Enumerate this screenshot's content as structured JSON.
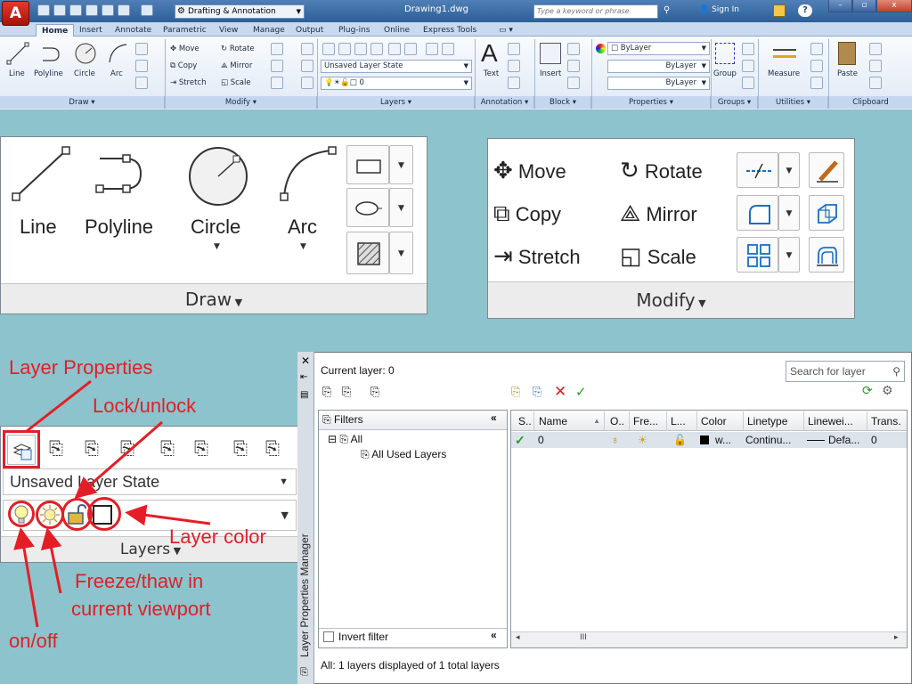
{
  "titlebar": {
    "app_button_label": "A",
    "workspace": "Drafting & Annotation",
    "document_title": "Drawing1.dwg",
    "search_placeholder": "Type a keyword or phrase",
    "sign_in": "Sign In",
    "help_label": "?",
    "minimize": "–",
    "maximize": "▫",
    "close": "x"
  },
  "tabs": [
    "Home",
    "Insert",
    "Annotate",
    "Parametric",
    "View",
    "Manage",
    "Output",
    "Plug-ins",
    "Online",
    "Express Tools"
  ],
  "ribbon": {
    "draw": {
      "title": "Draw ▾",
      "tools": [
        "Line",
        "Polyline",
        "Circle",
        "Arc"
      ]
    },
    "modify": {
      "title": "Modify ▾",
      "tools": [
        "Move",
        "Rotate",
        "Copy",
        "Mirror",
        "Stretch",
        "Scale"
      ]
    },
    "layers": {
      "title": "Layers ▾",
      "state": "Unsaved Layer State",
      "current": "0"
    },
    "annotation": {
      "title": "Annotation ▾",
      "text_label": "Text"
    },
    "block": {
      "title": "Block ▾",
      "insert_label": "Insert"
    },
    "properties": {
      "title": "Properties ▾",
      "color": "ByLayer",
      "linetype": "ByLayer",
      "lineweight": "ByLayer"
    },
    "groups": {
      "title": "Groups ▾",
      "group_label": "Group"
    },
    "utilities": {
      "title": "Utilities ▾",
      "measure_label": "Measure"
    },
    "clipboard": {
      "title": "Clipboard",
      "paste_label": "Paste"
    }
  },
  "zoom_draw": {
    "tools": [
      "Line",
      "Polyline",
      "Circle",
      "Arc"
    ],
    "footer": "Draw"
  },
  "zoom_modify": {
    "tools": [
      "Move",
      "Rotate",
      "Copy",
      "Mirror",
      "Stretch",
      "Scale"
    ],
    "footer": "Modify"
  },
  "zoom_layers": {
    "state": "Unsaved Layer State",
    "footer": "Layers"
  },
  "annotations": {
    "layer_properties": "Layer Properties",
    "lock_unlock": "Lock/unlock",
    "layer_color": "Layer color",
    "freeze_line1": "Freeze/thaw in",
    "freeze_line2": "current viewport",
    "on_off": "on/off"
  },
  "layer_manager": {
    "side_title": "Layer Properties Manager",
    "current_layer": "Current layer: 0",
    "search_placeholder": "Search for layer",
    "filters_label": "Filters",
    "tree_all": "All",
    "tree_used": "All Used Layers",
    "invert_filter": "Invert filter",
    "status": "All: 1 layers displayed of 1 total layers",
    "scroll_mid": "III",
    "columns": [
      "S..",
      "Name",
      "O..",
      "Fre...",
      "L...",
      "Color",
      "Linetype",
      "Linewei...",
      "Trans."
    ],
    "row": {
      "status_icon": "check-icon",
      "name": "0",
      "on_icon": "bulb-icon",
      "freeze_icon": "sun-icon",
      "lock_icon": "unlock-icon",
      "color": "w...",
      "linetype": "Continu...",
      "lineweight": "Defa...",
      "transparency": "0"
    }
  },
  "colors": {
    "annotation_red": "#e41e26",
    "ribbon_blue": "#2d5f98",
    "background": "#8cc3cc"
  }
}
